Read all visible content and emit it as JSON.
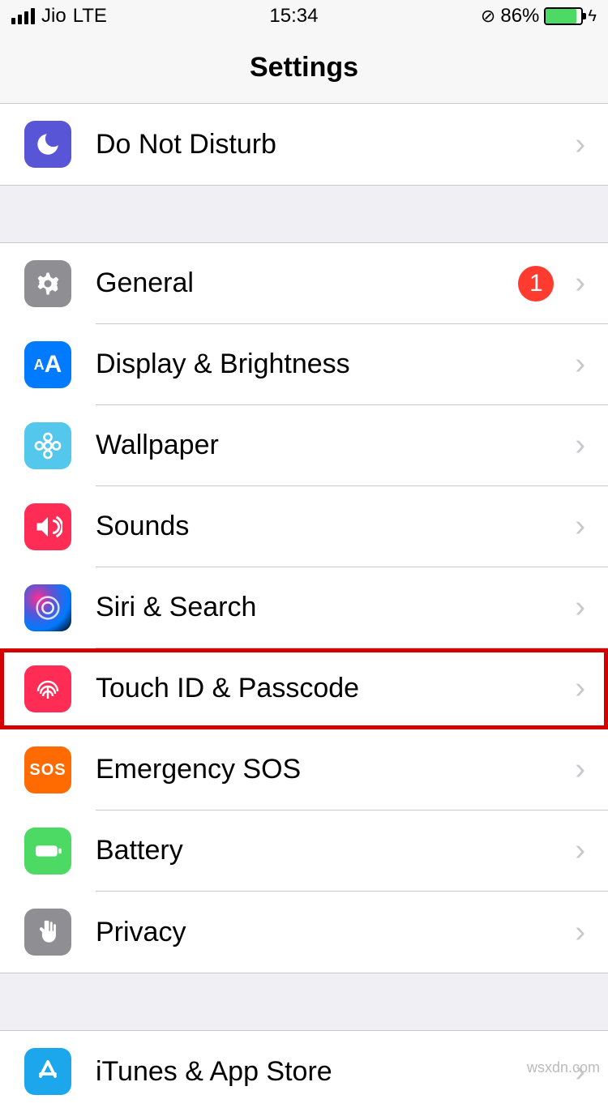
{
  "status": {
    "carrier": "Jio",
    "network": "LTE",
    "time": "15:34",
    "battery_pct": "86%"
  },
  "nav": {
    "title": "Settings"
  },
  "rows": {
    "dnd": {
      "label": "Do Not Disturb"
    },
    "general": {
      "label": "General",
      "badge": "1"
    },
    "display": {
      "label": "Display & Brightness"
    },
    "wallpaper": {
      "label": "Wallpaper"
    },
    "sounds": {
      "label": "Sounds"
    },
    "siri": {
      "label": "Siri & Search"
    },
    "touchid": {
      "label": "Touch ID & Passcode"
    },
    "sos": {
      "label": "Emergency SOS",
      "icon_text": "SOS"
    },
    "battery": {
      "label": "Battery"
    },
    "privacy": {
      "label": "Privacy"
    },
    "appstore": {
      "label": "iTunes & App Store"
    }
  },
  "watermark": "wsxdn.com"
}
